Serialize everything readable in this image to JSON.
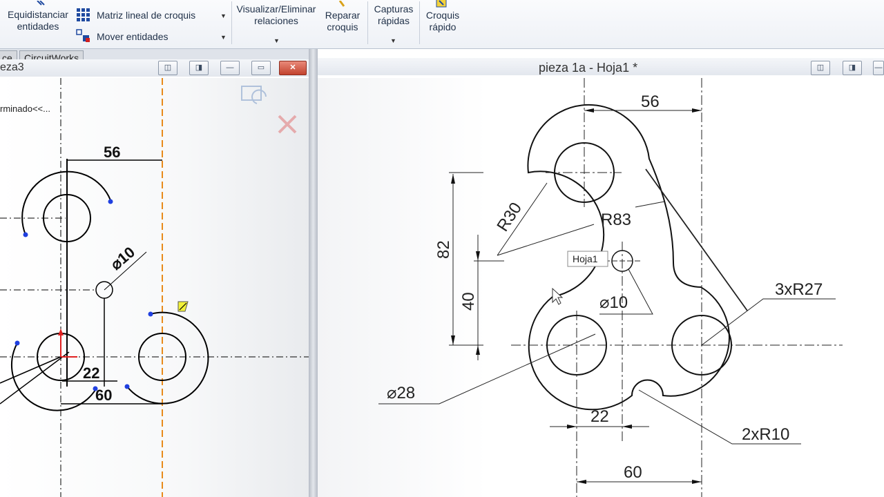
{
  "ribbon": {
    "equidistanciar": "Equidistanciar",
    "entidades": "entidades",
    "matriz": "Matriz lineal de croquis",
    "mover": "Mover entidades",
    "visualizar": "Visualizar/Eliminar",
    "relaciones": "relaciones",
    "reparar": "Reparar",
    "croquis": "croquis",
    "capturas": "Capturas",
    "rapidas": "rápidas",
    "croquis2": "Croquis",
    "rapido": "rápido"
  },
  "tabs": [
    "ce",
    "CircuitWorks"
  ],
  "left_window": {
    "title_fragment": "eza3",
    "status_text": "rminado<<..."
  },
  "right_window": {
    "title": "pieza 1a - Hoja1 *",
    "tooltip": "Hoja1"
  },
  "left_dims": {
    "d56": "56",
    "dia10": "⌀10",
    "d22": "22",
    "d60": "60"
  },
  "right_dims": {
    "d56": "56",
    "d82": "82",
    "d40": "40",
    "r30": "R30",
    "r83": "R83",
    "dia10": "⌀10",
    "r27": "3xR27",
    "dia28": "⌀28",
    "d22": "22",
    "r10": "2xR10",
    "d60": "60"
  },
  "colors": {
    "accent": "#e88a1a",
    "point": "#2040e0",
    "origin": "#e02020",
    "close": "#c2432e"
  }
}
